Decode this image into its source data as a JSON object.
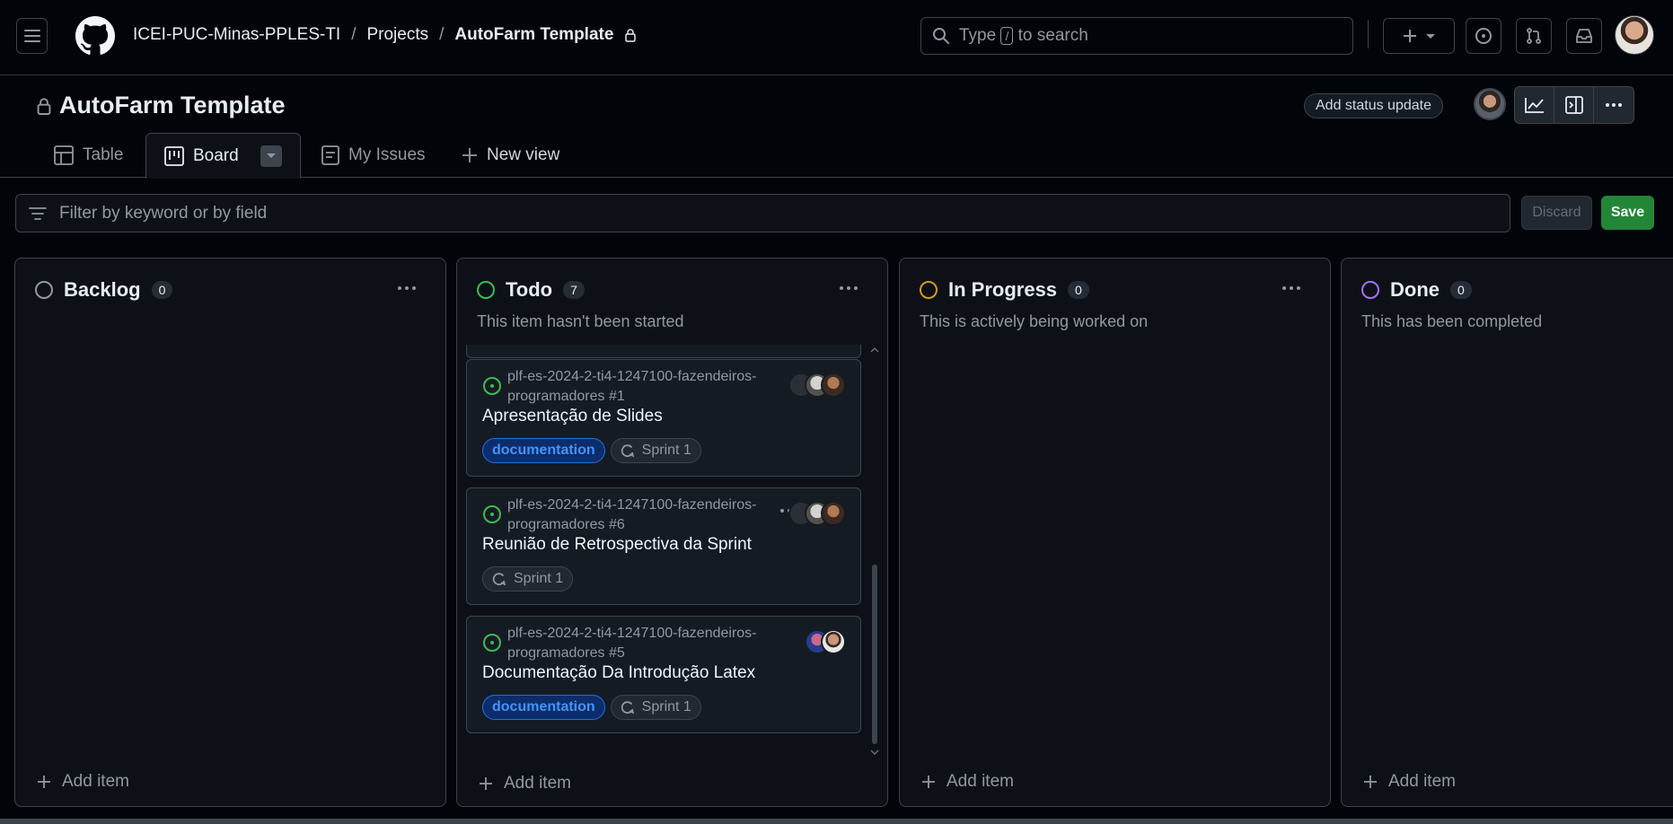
{
  "header": {
    "breadcrumbs": [
      "ICEI-PUC-Minas-PPLES-TI",
      "Projects",
      "AutoFarm Template"
    ],
    "search_before": "Type",
    "search_key": "/",
    "search_after": "to search"
  },
  "project": {
    "title": "AutoFarm Template",
    "status_button": "Add status update"
  },
  "tabs": [
    {
      "label": "Table"
    },
    {
      "label": "Board"
    },
    {
      "label": "My Issues"
    },
    {
      "label": "New view"
    }
  ],
  "filter": {
    "placeholder": "Filter by keyword or by field",
    "discard": "Discard",
    "save": "Save"
  },
  "columns": [
    {
      "name": "Backlog",
      "count": "0",
      "description": "",
      "color": "#9198a1",
      "add_item": "Add item"
    },
    {
      "name": "Todo",
      "count": "7",
      "description": "This item hasn't been started",
      "color": "#3fb950",
      "add_item": "Add item"
    },
    {
      "name": "In Progress",
      "count": "0",
      "description": "This is actively being worked on",
      "color": "#d29922",
      "add_item": "Add item"
    },
    {
      "name": "Done",
      "count": "0",
      "description": "This has been completed",
      "color": "#a371f7",
      "add_item": "Add item"
    }
  ],
  "todo_cards": [
    {
      "repo": "plf-es-2024-2-ti4-1247100-fazendeiros-programadores #1",
      "title": "Apresentação de Slides",
      "label": "documentation",
      "sprint": "Sprint 1"
    },
    {
      "repo": "plf-es-2024-2-ti4-1247100-fazendeiros-programadores #6",
      "title": "Reunião de Retrospectiva da Sprint",
      "label": "",
      "sprint": "Sprint 1"
    },
    {
      "repo": "plf-es-2024-2-ti4-1247100-fazendeiros-programadores #5",
      "title": "Documentação Da Introdução Latex",
      "label": "documentation",
      "sprint": "Sprint 1"
    }
  ],
  "colors": {
    "bg": "#010409",
    "panel": "#0d1117",
    "card": "#151b23",
    "border": "#3d444d",
    "save_green": "#238636",
    "label_blue": "#4493f8"
  }
}
